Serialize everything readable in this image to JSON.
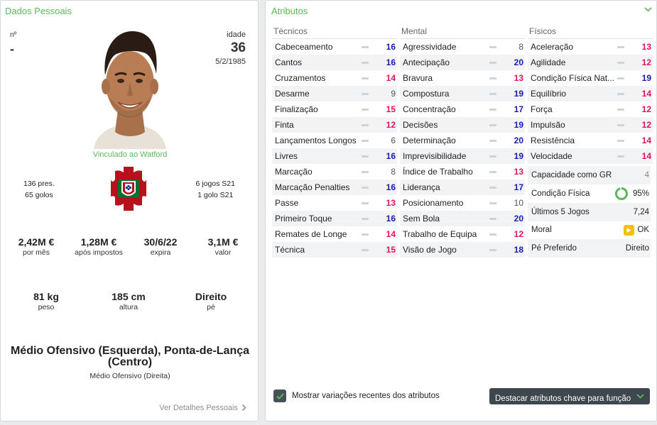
{
  "personal": {
    "title": "Dados Pessoais",
    "number_label": "nº",
    "number_value": "-",
    "age_label": "idade",
    "age_value": "36",
    "dob": "5/2/1985",
    "contract_status": "Vinculado ao Watford",
    "caps": "136 pres.",
    "goals": "65 golos",
    "season_games": "6 jogos S21",
    "season_goals": "1 golo S21",
    "finances": [
      {
        "value": "2,42M €",
        "label": "por mês"
      },
      {
        "value": "1,28M €",
        "label": "após impostos"
      },
      {
        "value": "30/6/22",
        "label": "expira"
      },
      {
        "value": "3,1M €",
        "label": "valor"
      }
    ],
    "physical": [
      {
        "value": "81 kg",
        "label": "peso"
      },
      {
        "value": "185 cm",
        "label": "altura"
      },
      {
        "value": "Direito",
        "label": "pé"
      }
    ],
    "position_main": "Médio Ofensivo (Esquerda), Ponta-de-Lança (Centro)",
    "position_secondary": "Médio Ofensivo (Direita)",
    "details_link": "Ver Detalhes Pessoais",
    "colors": {
      "green": "#5cb85c",
      "crest_red": "#b8101c",
      "crest_green": "#0a6e2e"
    }
  },
  "attributes": {
    "title": "Atributos",
    "technical": {
      "label": "Técnicos",
      "items": [
        {
          "name": "Cabeceamento",
          "value": 16
        },
        {
          "name": "Cantos",
          "value": 16
        },
        {
          "name": "Cruzamentos",
          "value": 14
        },
        {
          "name": "Desarme",
          "value": 9
        },
        {
          "name": "Finalização",
          "value": 15
        },
        {
          "name": "Finta",
          "value": 12
        },
        {
          "name": "Lançamentos Longos",
          "value": 6
        },
        {
          "name": "Livres",
          "value": 16
        },
        {
          "name": "Marcação",
          "value": 8
        },
        {
          "name": "Marcação Penalties",
          "value": 16
        },
        {
          "name": "Passe",
          "value": 13
        },
        {
          "name": "Primeiro Toque",
          "value": 16
        },
        {
          "name": "Remates de Longe",
          "value": 14
        },
        {
          "name": "Técnica",
          "value": 15
        }
      ]
    },
    "mental": {
      "label": "Mental",
      "items": [
        {
          "name": "Agressividade",
          "value": 8
        },
        {
          "name": "Antecipação",
          "value": 20
        },
        {
          "name": "Bravura",
          "value": 13
        },
        {
          "name": "Compostura",
          "value": 19
        },
        {
          "name": "Concentração",
          "value": 17
        },
        {
          "name": "Decisões",
          "value": 19
        },
        {
          "name": "Determinação",
          "value": 20
        },
        {
          "name": "Imprevisibilidade",
          "value": 19
        },
        {
          "name": "Índice de Trabalho",
          "value": 13
        },
        {
          "name": "Liderança",
          "value": 17
        },
        {
          "name": "Posicionamento",
          "value": 10
        },
        {
          "name": "Sem Bola",
          "value": 20
        },
        {
          "name": "Trabalho de Equipa",
          "value": 12
        },
        {
          "name": "Visão de Jogo",
          "value": 18
        }
      ]
    },
    "physical": {
      "label": "Físicos",
      "items": [
        {
          "name": "Aceleração",
          "value": 13
        },
        {
          "name": "Agilidade",
          "value": 12
        },
        {
          "name": "Condição Física Nat...",
          "value": 19
        },
        {
          "name": "Equilíbrio",
          "value": 14
        },
        {
          "name": "Força",
          "value": 12
        },
        {
          "name": "Impulsão",
          "value": 12
        },
        {
          "name": "Resistência",
          "value": 14
        },
        {
          "name": "Velocidade",
          "value": 14
        }
      ]
    },
    "extra": {
      "gk_label": "Capacidade como GR",
      "gk_value": "4",
      "fitness_label": "Condição Física",
      "fitness_value": "95%",
      "fitness_fraction": 0.95,
      "last5_label": "Últimos 5 Jogos",
      "last5_value": "7,24",
      "morale_label": "Moral",
      "morale_value": "OK",
      "foot_label": "Pé Preferido",
      "foot_value": "Direito"
    },
    "show_changes_label": "Mostrar variações recentes dos atributos",
    "highlight_button": "Destacar atributos chave para função",
    "colors": {
      "high": "#1a1ab3",
      "mid": "#e0115f",
      "low": "#555555",
      "fitness": "#5cb85c",
      "morale": "#f2c200"
    }
  }
}
